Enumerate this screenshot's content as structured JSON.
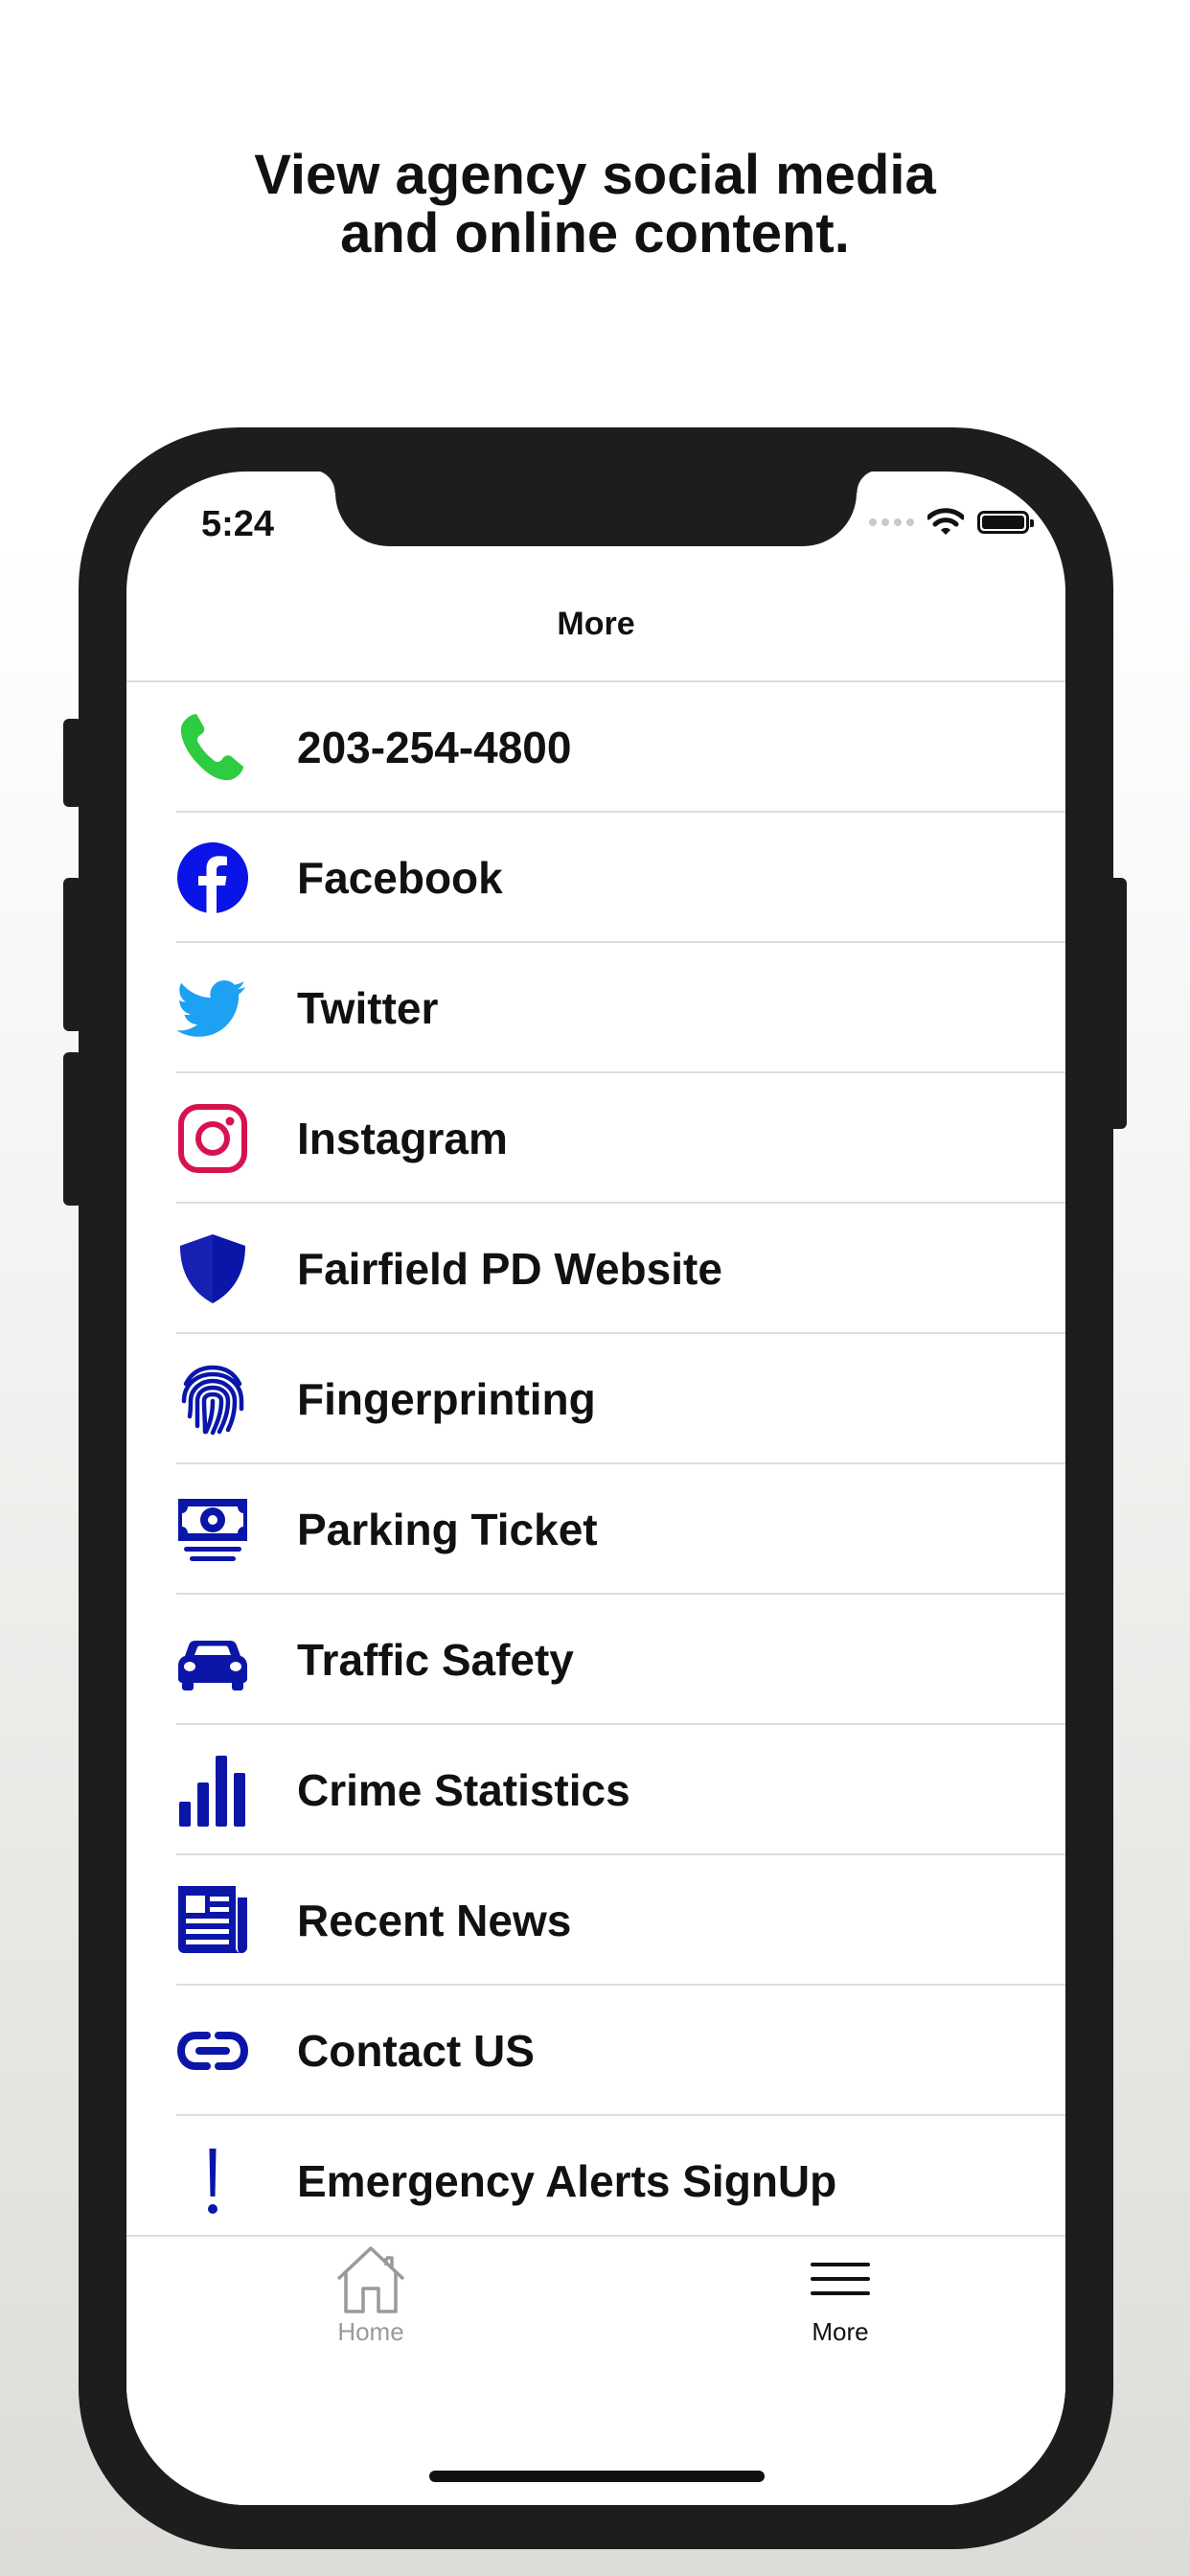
{
  "headline": {
    "line1": "View agency social media",
    "line2": "and online content."
  },
  "status_bar": {
    "time": "5:24",
    "icons": [
      "signal-dots-icon",
      "wifi-icon",
      "battery-icon"
    ]
  },
  "nav": {
    "title": "More"
  },
  "menu": {
    "items": [
      {
        "label": "203-254-4800",
        "icon": "phone-icon",
        "color": "#2ecc40"
      },
      {
        "label": "Facebook",
        "icon": "facebook-icon",
        "color": "#0a14e6"
      },
      {
        "label": "Twitter",
        "icon": "twitter-icon",
        "color": "#1da1f2"
      },
      {
        "label": "Instagram",
        "icon": "instagram-icon",
        "color": "#d6134f"
      },
      {
        "label": "Fairfield PD Website",
        "icon": "shield-icon",
        "color": "#0b16a8"
      },
      {
        "label": "Fingerprinting",
        "icon": "fingerprint-icon",
        "color": "#0b16a8"
      },
      {
        "label": "Parking Ticket",
        "icon": "money-bill-icon",
        "color": "#0b16a8"
      },
      {
        "label": "Traffic Safety",
        "icon": "car-icon",
        "color": "#0b16a8"
      },
      {
        "label": "Crime Statistics",
        "icon": "bar-chart-icon",
        "color": "#0b16a8"
      },
      {
        "label": "Recent News",
        "icon": "newspaper-icon",
        "color": "#0b16a8"
      },
      {
        "label": "Contact US",
        "icon": "link-icon",
        "color": "#0b16a8"
      },
      {
        "label": "Emergency Alerts SignUp",
        "icon": "exclamation-icon",
        "color": "#0b16a8"
      }
    ]
  },
  "tabbar": {
    "tabs": [
      {
        "label": "Home",
        "icon": "home-icon",
        "active": false,
        "color": "#9a9a9a"
      },
      {
        "label": "More",
        "icon": "menu-icon",
        "active": true,
        "color": "#111111"
      }
    ]
  }
}
